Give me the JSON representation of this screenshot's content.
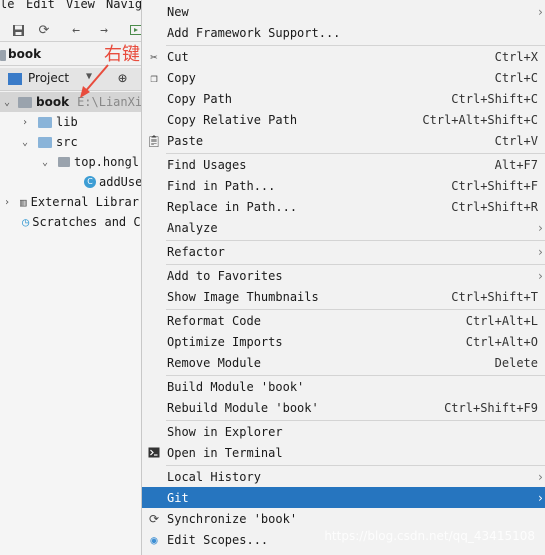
{
  "menubar": {
    "items": [
      "le",
      "Edit",
      "View",
      "Navig"
    ]
  },
  "project_panel": {
    "project_label": "Project",
    "tree": [
      {
        "label": "book",
        "path": "E:\\LianXi",
        "depth": 0,
        "expanded": true,
        "type": "module"
      },
      {
        "label": "lib",
        "depth": 1,
        "expanded": false,
        "type": "folder"
      },
      {
        "label": "src",
        "depth": 1,
        "expanded": true,
        "type": "folder"
      },
      {
        "label": "top.hongl",
        "depth": 2,
        "expanded": true,
        "type": "package"
      },
      {
        "label": "addUse",
        "depth": 3,
        "type": "class"
      },
      {
        "label": "External Librar",
        "depth": 0,
        "expanded": false,
        "type": "libraries"
      },
      {
        "label": "Scratches and C",
        "depth": 0,
        "type": "scratches"
      }
    ],
    "top_item": "book"
  },
  "annotation": {
    "text": "右键"
  },
  "context_menu": {
    "items": [
      {
        "label": "New",
        "shortcut": "",
        "submenu": true,
        "icon": ""
      },
      {
        "label": "Add Framework Support...",
        "shortcut": "",
        "submenu": false,
        "icon": ""
      },
      {
        "label": "Cut",
        "shortcut": "Ctrl+X",
        "submenu": false,
        "icon": "scissors-icon"
      },
      {
        "label": "Copy",
        "shortcut": "Ctrl+C",
        "submenu": false,
        "icon": "copy-icon"
      },
      {
        "label": "Copy Path",
        "shortcut": "Ctrl+Shift+C",
        "submenu": false,
        "icon": ""
      },
      {
        "label": "Copy Relative Path",
        "shortcut": "Ctrl+Alt+Shift+C",
        "submenu": false,
        "icon": ""
      },
      {
        "label": "Paste",
        "shortcut": "Ctrl+V",
        "submenu": false,
        "icon": "clipboard-icon"
      },
      {
        "label": "Find Usages",
        "shortcut": "Alt+F7",
        "submenu": false,
        "icon": ""
      },
      {
        "label": "Find in Path...",
        "shortcut": "Ctrl+Shift+F",
        "submenu": false,
        "icon": ""
      },
      {
        "label": "Replace in Path...",
        "shortcut": "Ctrl+Shift+R",
        "submenu": false,
        "icon": ""
      },
      {
        "label": "Analyze",
        "shortcut": "",
        "submenu": true,
        "icon": ""
      },
      {
        "label": "Refactor",
        "shortcut": "",
        "submenu": true,
        "icon": ""
      },
      {
        "label": "Add to Favorites",
        "shortcut": "",
        "submenu": true,
        "icon": ""
      },
      {
        "label": "Show Image Thumbnails",
        "shortcut": "Ctrl+Shift+T",
        "submenu": false,
        "icon": ""
      },
      {
        "label": "Reformat Code",
        "shortcut": "Ctrl+Alt+L",
        "submenu": false,
        "icon": ""
      },
      {
        "label": "Optimize Imports",
        "shortcut": "Ctrl+Alt+O",
        "submenu": false,
        "icon": ""
      },
      {
        "label": "Remove Module",
        "shortcut": "Delete",
        "submenu": false,
        "icon": ""
      },
      {
        "label": "Build Module 'book'",
        "shortcut": "",
        "submenu": false,
        "icon": ""
      },
      {
        "label": "Rebuild Module 'book'",
        "shortcut": "Ctrl+Shift+F9",
        "submenu": false,
        "icon": ""
      },
      {
        "label": "Show in Explorer",
        "shortcut": "",
        "submenu": false,
        "icon": ""
      },
      {
        "label": "Open in Terminal",
        "shortcut": "",
        "submenu": false,
        "icon": "terminal-icon"
      },
      {
        "label": "Local History",
        "shortcut": "",
        "submenu": true,
        "icon": ""
      },
      {
        "label": "Git",
        "shortcut": "",
        "submenu": true,
        "icon": "",
        "active": true
      },
      {
        "label": "Synchronize 'book'",
        "shortcut": "",
        "submenu": false,
        "icon": "sync-icon"
      },
      {
        "label": "Edit Scopes...",
        "shortcut": "",
        "submenu": false,
        "icon": "scope-icon"
      }
    ],
    "watermark": "https://blog.csdn.net/qq_43415108"
  },
  "colors": {
    "active": "#2675bf",
    "annotation": "#e84c3d"
  }
}
